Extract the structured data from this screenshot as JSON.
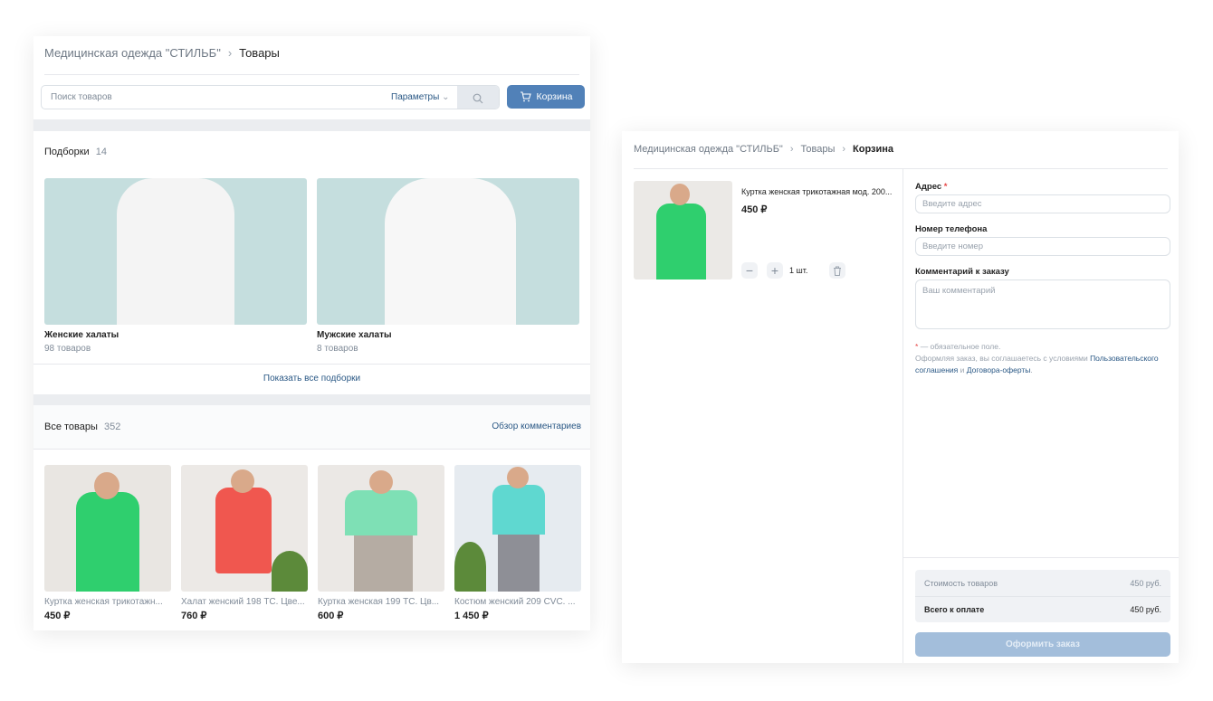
{
  "shop": {
    "breadcrumb": [
      "Медицинская одежда \"СТИЛЬБ\"",
      "Товары"
    ],
    "search": {
      "placeholder": "Поиск товаров",
      "params_label": "Параметры"
    },
    "cart_button": "Корзина",
    "collections": {
      "title": "Подборки",
      "count": "14",
      "items": [
        {
          "name": "Женские халаты",
          "count": "98 товаров"
        },
        {
          "name": "Мужские халаты",
          "count": "8 товаров"
        }
      ],
      "show_all": "Показать все подборки"
    },
    "products": {
      "title": "Все товары",
      "count": "352",
      "reviews_link": "Обзор комментариев",
      "items": [
        {
          "name": "Куртка женская трикотажн...",
          "price": "450 ₽"
        },
        {
          "name": "Халат женский 198 ТС. Цве...",
          "price": "760 ₽"
        },
        {
          "name": "Куртка женская 199 ТС. Цв...",
          "price": "600 ₽"
        },
        {
          "name": "Костюм женский 209 CVC. ...",
          "price": "1 450 ₽"
        }
      ]
    }
  },
  "cart": {
    "breadcrumb": [
      "Медицинская одежда \"СТИЛЬБ\"",
      "Товары",
      "Корзина"
    ],
    "item": {
      "name": "Куртка женская трикотажная мод. 200...",
      "price": "450 ₽",
      "qty": "1 шт."
    },
    "form": {
      "address_label": "Адрес",
      "required_mark": "*",
      "address_placeholder": "Введите адрес",
      "phone_label": "Номер телефона",
      "phone_placeholder": "Введите номер",
      "comment_label": "Комментарий к заказу",
      "comment_placeholder": "Ваш комментарий",
      "note_required": "— обязательное поле.",
      "note_agree": "Оформляя заказ, вы соглашаетесь с условиями ",
      "link_user": "Пользовательского соглашения",
      "note_and": " и ",
      "link_offer": "Договора-оферты",
      "note_end": "."
    },
    "summary": {
      "goods_label": "Стоимость товаров",
      "goods_value": "450 руб.",
      "total_label": "Всего к оплате",
      "total_value": "450 руб."
    },
    "checkout_button": "Оформить заказ"
  },
  "colors": {
    "accent": "#5181b8",
    "checkout_disabled": "#a3bedb",
    "image_bg": "#c5dede",
    "green": "#2fcf6e"
  }
}
